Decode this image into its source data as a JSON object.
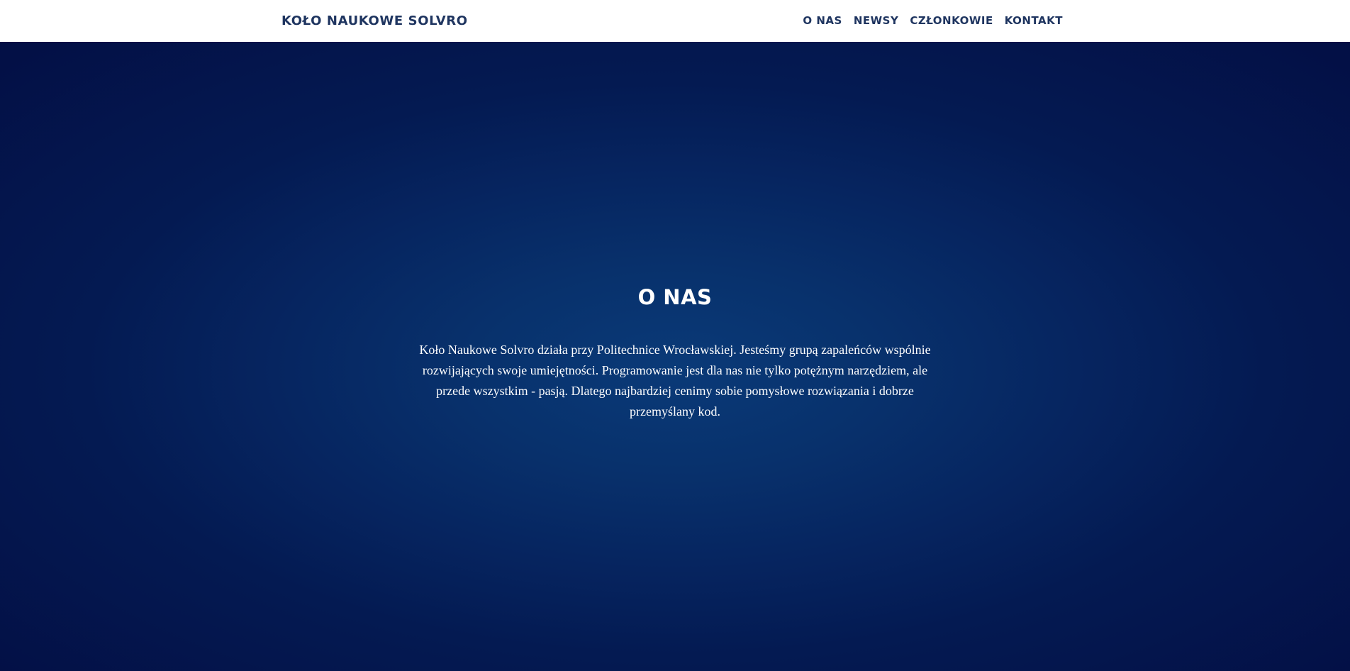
{
  "navbar": {
    "brand": "KOŁO NAUKOWE SOLVRO",
    "links": [
      {
        "label": "O NAS"
      },
      {
        "label": "NEWSY"
      },
      {
        "label": "CZŁONKOWIE"
      },
      {
        "label": "KONTAKT"
      }
    ]
  },
  "about": {
    "title": "O NAS",
    "text": "Koło Naukowe Solvro działa przy Politechnice Wrocławskiej. Jesteśmy grupą zapaleńców wspólnie rozwijających swoje umiejętności. Programowanie jest dla nas nie tylko potężnym narzędziem, ale przede wszystkim - pasją. Dlatego najbardziej cenimy sobie pomysłowe rozwiązania i dobrze przemyślany kod."
  },
  "colors": {
    "navbar_background": "#ffffff",
    "navbar_text": "#1f3560",
    "hero_center": "#0a3a78",
    "hero_edge": "#030f45",
    "hero_text": "#ffffff"
  }
}
